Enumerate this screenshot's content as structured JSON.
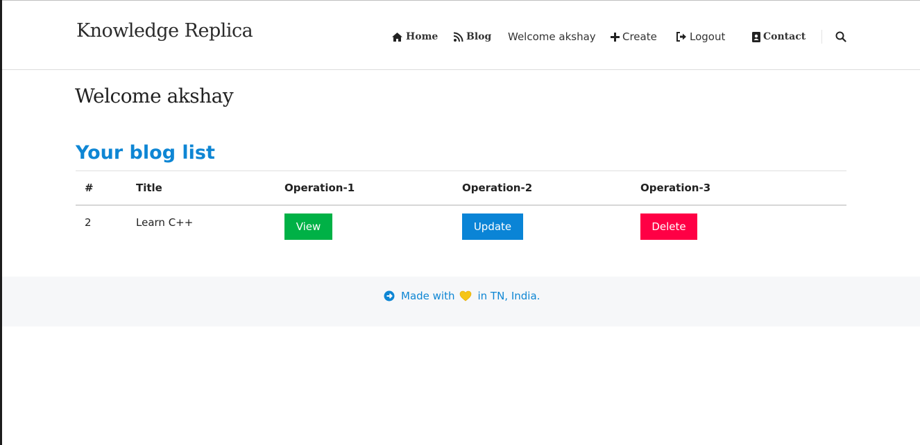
{
  "site": {
    "brand": "Knowledge Replica"
  },
  "nav": {
    "home": "Home",
    "blog": "Blog",
    "welcome": "Welcome akshay",
    "create": "Create",
    "logout": "Logout",
    "contact": "Contact"
  },
  "icons": {
    "home": "home-icon",
    "blog": "rss-icon",
    "create": "plus-icon",
    "logout": "sign-out-icon",
    "contact": "address-book-icon",
    "search": "search-icon",
    "footer_arrow": "arrow-circle-icon",
    "heart": "yellow-heart-icon"
  },
  "main": {
    "welcome_heading": "Welcome akshay",
    "list_title": "Your blog list"
  },
  "table": {
    "headers": [
      "#",
      "Title",
      "Operation-1",
      "Operation-2",
      "Operation-3"
    ],
    "rows": [
      {
        "id": "2",
        "title": "Learn C++",
        "view": "View",
        "update": "Update",
        "delete": "Delete"
      }
    ]
  },
  "footer": {
    "made_with": "Made with",
    "location": "in TN, India."
  },
  "colors": {
    "accent": "#0e86d4",
    "view": "#00b146",
    "update": "#0a84d6",
    "delete": "#ff0045",
    "heart": "#f5c518"
  }
}
